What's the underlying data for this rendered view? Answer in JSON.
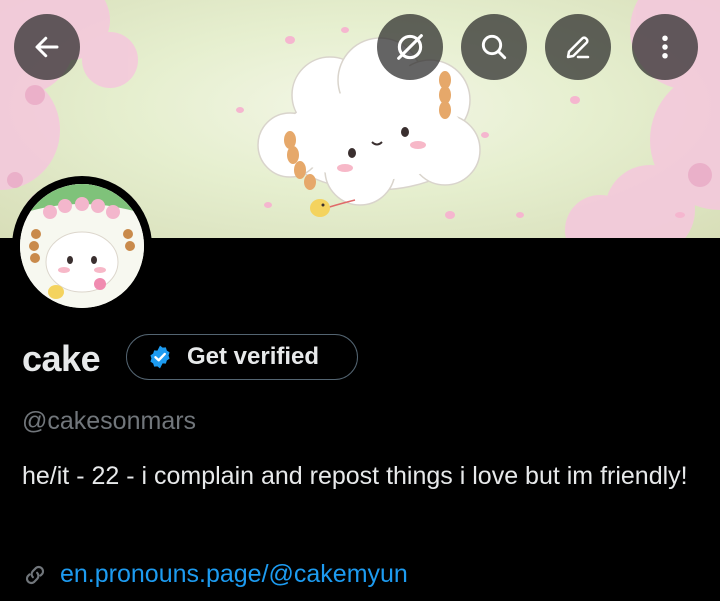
{
  "header": {
    "back_icon": "arrow-left-icon",
    "mute_icon": "notifications-off-icon",
    "search_icon": "search-icon",
    "edit_icon": "pencil-icon",
    "more_icon": "more-vertical-icon"
  },
  "profile": {
    "display_name": "cake",
    "get_verified_label": "Get verified",
    "verified_badge_icon": "verified-badge-icon",
    "handle": "@cakesonmars",
    "bio": "he/it - 22 - i complain and repost things i love but im friendly!",
    "link_icon": "link-icon",
    "link": "en.pronouns.page/@cakemyun"
  },
  "colors": {
    "background": "#000000",
    "text_primary": "#e7e9ea",
    "text_secondary": "#71767b",
    "link": "#1d9bf0",
    "verified_badge": "#1d9bf0",
    "button_border": "#536471"
  }
}
